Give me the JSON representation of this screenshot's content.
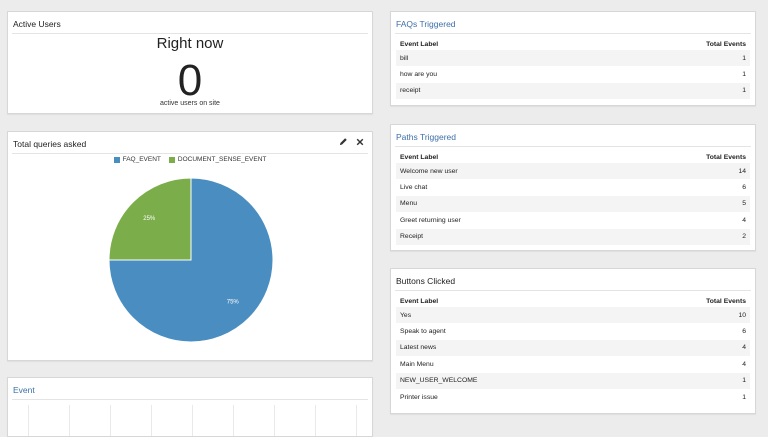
{
  "active_users": {
    "title": "Active Users",
    "right_now": "Right now",
    "count": "0",
    "caption": "active users on site"
  },
  "queries": {
    "title": "Total queries asked",
    "edit_icon": "pencil-icon",
    "close_icon": "close-icon",
    "close_label": "✕"
  },
  "chart_data": {
    "type": "pie",
    "title": "Total queries asked",
    "legend_position": "top",
    "series": [
      {
        "name": "FAQ_EVENT",
        "value": 75,
        "label": "75%",
        "color": "#4a8dc1"
      },
      {
        "name": "DOCUMENT_SENSE_EVENT",
        "value": 25,
        "label": "25%",
        "color": "#7bae4b"
      }
    ]
  },
  "event": {
    "title": "Event"
  },
  "faqs": {
    "title": "FAQs Triggered",
    "col_label": "Event Label",
    "col_total": "Total Events",
    "rows": [
      {
        "label": "bill",
        "total": "1"
      },
      {
        "label": "how are you",
        "total": "1"
      },
      {
        "label": "receipt",
        "total": "1"
      }
    ]
  },
  "paths": {
    "title": "Paths Triggered",
    "col_label": "Event Label",
    "col_total": "Total Events",
    "rows": [
      {
        "label": "Welcome new user",
        "total": "14"
      },
      {
        "label": "Live chat",
        "total": "6"
      },
      {
        "label": "Menu",
        "total": "5"
      },
      {
        "label": "Greet returning user",
        "total": "4"
      },
      {
        "label": "Receipt",
        "total": "2"
      }
    ]
  },
  "buttons": {
    "title": "Buttons Clicked",
    "col_label": "Event Label",
    "col_total": "Total Events",
    "rows": [
      {
        "label": "Yes",
        "total": "10"
      },
      {
        "label": "Speak to agent",
        "total": "6"
      },
      {
        "label": "Latest news",
        "total": "4"
      },
      {
        "label": "Main Menu",
        "total": "4"
      },
      {
        "label": "NEW_USER_WELCOME",
        "total": "1"
      },
      {
        "label": "Printer issue",
        "total": "1"
      }
    ]
  }
}
